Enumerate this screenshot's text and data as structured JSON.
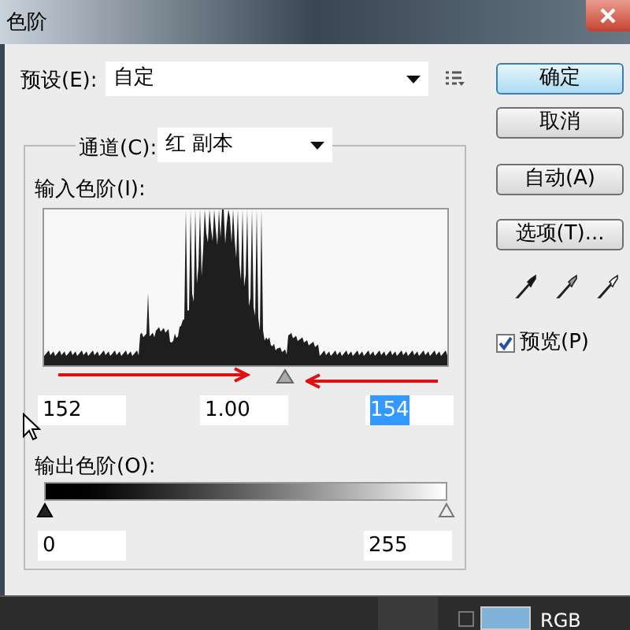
{
  "window": {
    "title": "色阶"
  },
  "preset": {
    "label": "预设(E):",
    "value": "自定"
  },
  "channel": {
    "label": "通道(C):",
    "value": "红 副本"
  },
  "input_levels": {
    "label": "输入色阶(I):",
    "fields": [
      {
        "value": "152",
        "selected": false
      },
      {
        "value": "1.00",
        "selected": false
      },
      {
        "value": "154",
        "selected": true
      }
    ]
  },
  "output_levels": {
    "label": "输出色阶(O):",
    "fields": [
      {
        "value": "0",
        "selected": false
      },
      {
        "value": "255",
        "selected": false
      }
    ]
  },
  "buttons": [
    {
      "label": "确定",
      "default": true
    },
    {
      "label": "取消",
      "default": false
    },
    {
      "label": "自动(A)",
      "default": false
    },
    {
      "label": "选项(T)...",
      "default": false
    }
  ],
  "preview": {
    "label": "预览(P)",
    "checked": true
  },
  "background_layer": {
    "label": "RGB",
    "visible": false
  }
}
